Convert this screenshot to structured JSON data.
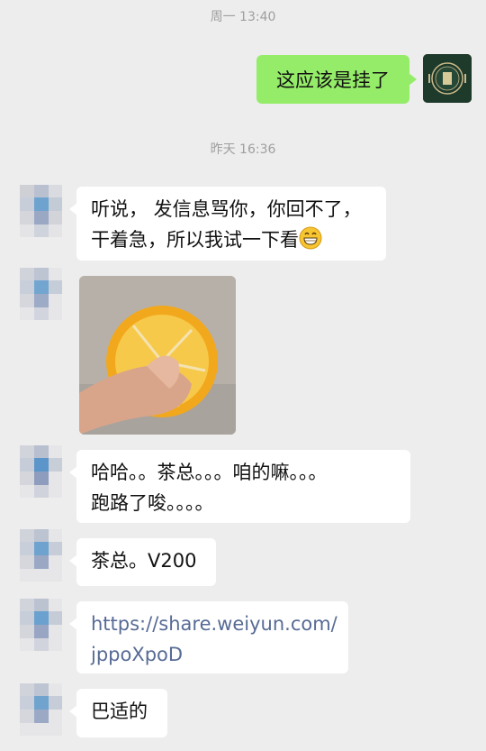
{
  "timestamps": [
    "周一 13:40",
    "昨天 16:36"
  ],
  "outgoing": [
    {
      "text": "这应该是挂了"
    }
  ],
  "incoming": [
    {
      "lines": [
        "听说， 发信息骂你，你回不了，",
        "干着急，所以我试一下看"
      ],
      "emoji": "grinning-emoji"
    },
    {
      "type": "image",
      "image_desc_icon": "orange-photo"
    },
    {
      "lines": [
        "哈哈。。茶总。。。咱的嘛。。。",
        "跑路了唆。。。。"
      ]
    },
    {
      "lines": [
        "茶总。V200"
      ]
    },
    {
      "lines": [
        "https://share.weiyun.com/",
        "jppoXpoD"
      ],
      "is_link": true
    },
    {
      "lines": [
        "巴适的"
      ]
    }
  ],
  "colors": {
    "background": "#ededed",
    "outgoing_bubble": "#95ec69",
    "incoming_bubble": "#ffffff",
    "link": "#576b95",
    "timestamp": "#9e9e9e"
  }
}
